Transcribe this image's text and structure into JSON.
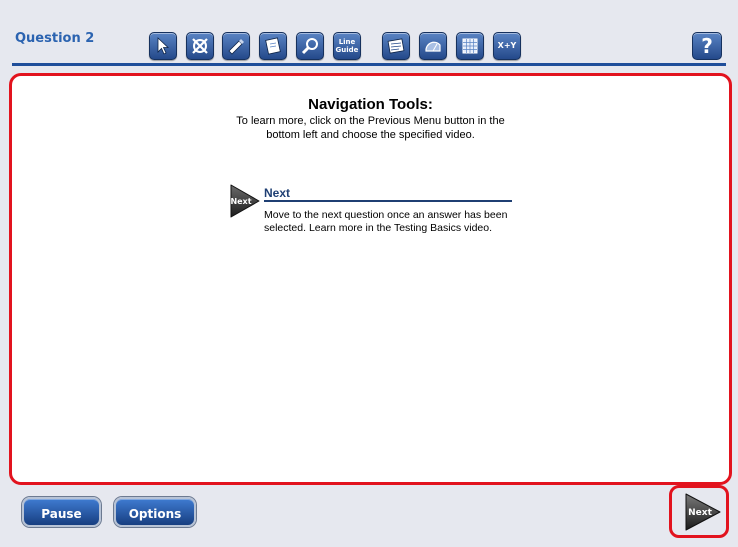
{
  "header": {
    "title": "Question 2",
    "tools": [
      {
        "name": "pointer-tool",
        "icon": "arrow-pointer-icon"
      },
      {
        "name": "eliminate-tool",
        "icon": "eliminate-x-icon"
      },
      {
        "name": "highlighter-tool",
        "icon": "highlighter-icon"
      },
      {
        "name": "notepad-tool",
        "icon": "notepad-icon"
      },
      {
        "name": "magnifier-tool",
        "icon": "magnifier-icon"
      },
      {
        "name": "line-guide-tool",
        "label_line1": "Line",
        "label_line2": "Guide"
      },
      {
        "name": "reference-sheet-tool",
        "icon": "reference-sheet-icon"
      },
      {
        "name": "protractor-tool",
        "icon": "protractor-icon"
      },
      {
        "name": "graph-paper-tool",
        "icon": "grid-icon"
      },
      {
        "name": "formula-tool",
        "label": "X+Y"
      }
    ],
    "help_label": "?"
  },
  "content": {
    "heading": "Navigation Tools:",
    "subtitle_line1": "To learn more, click on the Previous Menu button in the",
    "subtitle_line2": "bottom left and choose the specified video.",
    "tool_item": {
      "icon_label": "Next",
      "title": "Next",
      "desc_line1": "Move to the next question once an answer has been",
      "desc_line2": "selected. Learn more in the Testing Basics video."
    }
  },
  "footer": {
    "pause_label": "Pause",
    "options_label": "Options",
    "next_label": "Next"
  },
  "colors": {
    "accent": "#2b63b0",
    "highlight_outline": "#e2131e",
    "rule": "#1f4e9a"
  }
}
